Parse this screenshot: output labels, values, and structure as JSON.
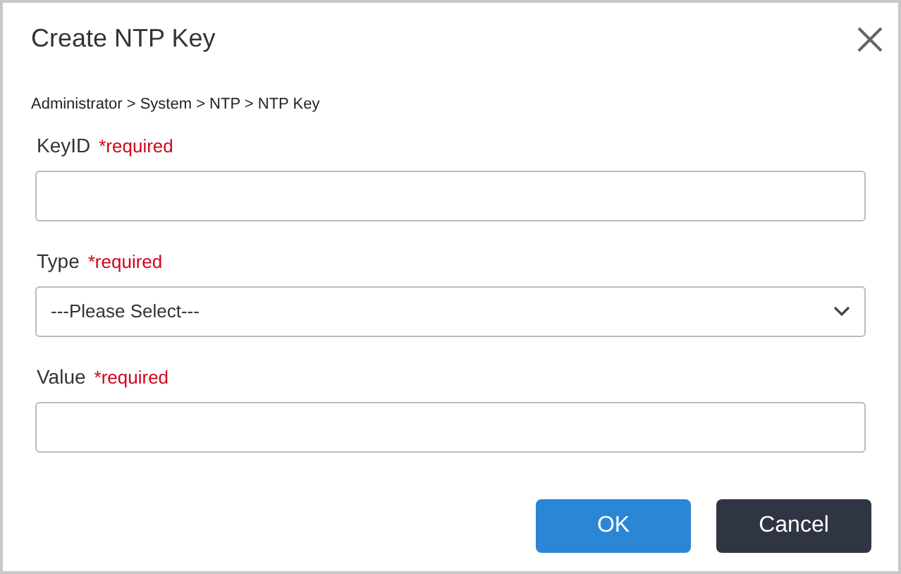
{
  "dialog": {
    "title": "Create NTP Key",
    "breadcrumb": "Administrator > System > NTP > NTP Key"
  },
  "fields": [
    {
      "kind": "input",
      "label": "KeyID",
      "required": "*required"
    },
    {
      "kind": "select",
      "label": "Type",
      "required": "*required",
      "value": "---Please Select---"
    },
    {
      "kind": "input",
      "label": "Value",
      "required": "*required"
    }
  ],
  "buttons": [
    {
      "kind": "primary",
      "label": "OK"
    },
    {
      "kind": "secondary",
      "label": "Cancel"
    }
  ]
}
